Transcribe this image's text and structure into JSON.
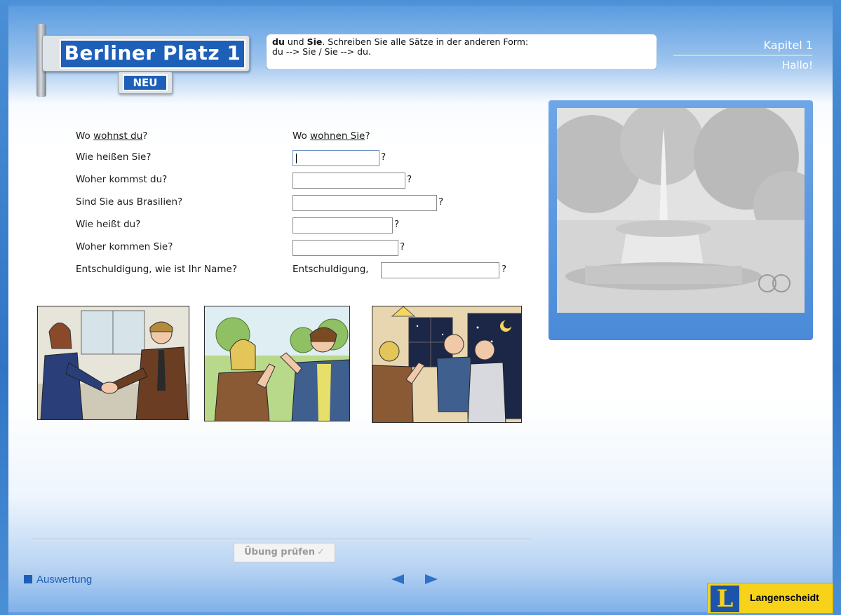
{
  "header": {
    "logo_title": "Berliner Platz 1",
    "logo_badge": "NEU",
    "instruction_bold_1": "du",
    "instruction_mid_1": " und ",
    "instruction_bold_2": "Sie",
    "instruction_rest": ". Schreiben Sie alle Sätze in der anderen Form:",
    "instruction_line2": "du --> Sie / Sie --> du.",
    "chapter": "Kapitel 1",
    "chapter_subtitle": "Hallo!"
  },
  "exercise": {
    "example_left_pre": "Wo ",
    "example_left_under": "wohnst du",
    "example_left_post": "?",
    "example_right_pre": "Wo ",
    "example_right_under": "wohnen Sie",
    "example_right_post": "?",
    "rows": [
      {
        "question": "Wie heißen Sie?",
        "prefix": "",
        "value": "",
        "suffix": "?"
      },
      {
        "question": "Woher kommst du?",
        "prefix": "",
        "value": "",
        "suffix": "?"
      },
      {
        "question": "Sind Sie aus Brasilien?",
        "prefix": "",
        "value": "",
        "suffix": "?"
      },
      {
        "question": "Wie heißt du?",
        "prefix": "",
        "value": "",
        "suffix": "?"
      },
      {
        "question": "Woher kommen Sie?",
        "prefix": "",
        "value": "",
        "suffix": "?"
      },
      {
        "question": "Entschuldigung, wie ist Ihr Name?",
        "prefix": "Entschuldigung,",
        "value": "",
        "suffix": "?"
      }
    ]
  },
  "footer": {
    "check_button": "Übung prüfen",
    "check_icon": "✓",
    "evaluation_link": "Auswertung",
    "publisher_mark": "L",
    "publisher": "Langenscheidt"
  },
  "colors": {
    "brand_blue": "#1e5fb8",
    "publisher_yellow": "#f6d21a",
    "frame_blue": "#4b8fd6"
  }
}
